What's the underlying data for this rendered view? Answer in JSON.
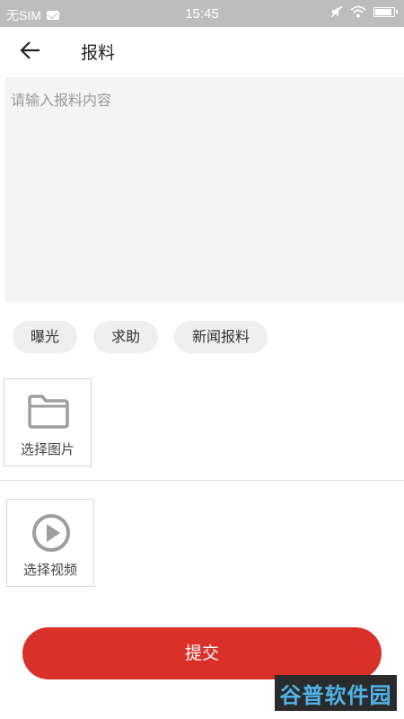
{
  "status_bar": {
    "carrier": "无SIM",
    "time": "15:45",
    "icons": [
      "mail-icon",
      "mute-icon",
      "wifi-icon",
      "battery-icon"
    ]
  },
  "header": {
    "title": "报料",
    "back_icon": "arrow-left-icon"
  },
  "content_input": {
    "placeholder": "请输入报料内容",
    "value": ""
  },
  "categories": [
    {
      "label": "曝光"
    },
    {
      "label": "求助"
    },
    {
      "label": "新闻报料"
    }
  ],
  "media": {
    "image": {
      "label": "选择图片",
      "icon": "folder-icon"
    },
    "video": {
      "label": "选择视频",
      "icon": "play-circle-icon"
    }
  },
  "submit_label": "提交",
  "watermark": "谷普软件园",
  "colors": {
    "accent": "#d9302a",
    "status_bar": "#bdbdbd",
    "input_bg": "#f4f4f4",
    "chip_bg": "#efefef"
  }
}
